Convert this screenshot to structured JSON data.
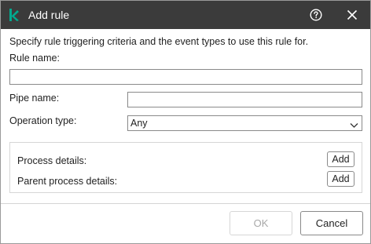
{
  "dialog": {
    "title": "Add rule",
    "intro": "Specify rule triggering criteria and the event types to use this rule for."
  },
  "form": {
    "rule_name": {
      "label": "Rule name:",
      "value": ""
    },
    "pipe_name": {
      "label": "Pipe name:",
      "value": ""
    },
    "operation_type": {
      "label": "Operation type:",
      "value": "Any"
    }
  },
  "process_panel": {
    "process_details_label": "Process details:",
    "process_add_label": "Add",
    "parent_process_details_label": "Parent process details:",
    "parent_process_add_label": "Add"
  },
  "footer": {
    "ok_label": "OK",
    "cancel_label": "Cancel",
    "ok_enabled": false
  },
  "icons": {
    "logo": "kaspersky-k-logo-icon",
    "help": "question-circle-icon",
    "close": "close-x-icon",
    "dropdown": "chevron-down-icon"
  },
  "colors": {
    "titlebar_bg": "#3b3b3b",
    "brand_green": "#00a88e",
    "disabled_text": "#a8a8a8"
  }
}
